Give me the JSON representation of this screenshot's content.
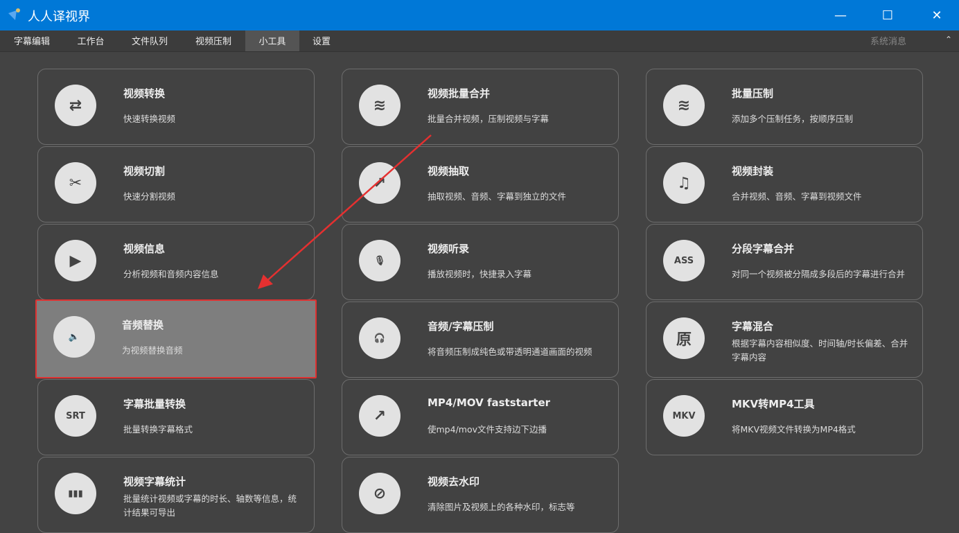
{
  "app": {
    "title": "人人译视界"
  },
  "window": {
    "minimize": "—",
    "maximize": "☐",
    "close": "✕"
  },
  "menu": {
    "tabs": [
      "字幕编辑",
      "工作台",
      "文件队列",
      "视频压制",
      "小工具",
      "设置"
    ],
    "active": "小工具",
    "system_messages": "系统消息",
    "collapse": "⌃"
  },
  "tools": [
    {
      "title": "视频转换",
      "desc": "快速转换视频",
      "icon": "convert-icon",
      "glyph": "⇄"
    },
    {
      "title": "视频批量合并",
      "desc": "批量合并视频，压制视频与字幕",
      "icon": "layers-icon",
      "glyph": "≋"
    },
    {
      "title": "批量压制",
      "desc": "添加多个压制任务，按顺序压制",
      "icon": "layers-icon",
      "glyph": "≋"
    },
    {
      "title": "视频切割",
      "desc": "快速分割视频",
      "icon": "scissors-icon",
      "glyph": "✂"
    },
    {
      "title": "视频抽取",
      "desc": "抽取视频、音频、字幕到独立的文件",
      "icon": "extract-icon",
      "glyph": "↗"
    },
    {
      "title": "视频封装",
      "desc": "合并视频、音频、字幕到视频文件",
      "icon": "package-icon",
      "glyph": "♫"
    },
    {
      "title": "视频信息",
      "desc": "分析视频和音频内容信息",
      "icon": "play-folder-icon",
      "glyph": "▶"
    },
    {
      "title": "视频听录",
      "desc": "播放视频时，快捷录入字幕",
      "icon": "mic-icon",
      "glyph": "🎙"
    },
    {
      "title": "分段字幕合并",
      "desc": "对同一个视频被分隔成多段后的字幕进行合并",
      "icon": "ass-merge-icon",
      "glyph": "ASS"
    },
    {
      "title": "音频替换",
      "desc": "为视频替换音频",
      "icon": "speaker-icon",
      "glyph": "🔈"
    },
    {
      "title": "音频/字幕压制",
      "desc": "将音频压制成纯色或带透明通道画面的视频",
      "icon": "headphones-icon",
      "glyph": "🎧"
    },
    {
      "title": "字幕混合",
      "desc": "根据字幕内容相似度、时间轴/时长偏差、合并字幕内容",
      "icon": "subtitle-mix-icon",
      "glyph": "原"
    },
    {
      "title": "字幕批量转换",
      "desc": "批量转换字幕格式",
      "icon": "srt-icon",
      "glyph": "SRT"
    },
    {
      "title": "MP4/MOV faststarter",
      "desc": "使mp4/mov文件支持边下边播",
      "icon": "extract-icon",
      "glyph": "↗"
    },
    {
      "title": "MKV转MP4工具",
      "desc": "将MKV视频文件转换为MP4格式",
      "icon": "mkv-mp4-icon",
      "glyph": "MKV"
    },
    {
      "title": "视频字幕统计",
      "desc": "批量统计视频或字幕的时长、轴数等信息，统计结果可导出",
      "icon": "bar-chart-icon",
      "glyph": "▮▮▮"
    },
    {
      "title": "视频去水印",
      "desc": "清除图片及视频上的各种水印，标志等",
      "icon": "watermark-icon",
      "glyph": "⊘"
    }
  ],
  "selected": "音频替换",
  "colors": {
    "titlebar": "#0078d7",
    "highlight": "#e03030"
  }
}
